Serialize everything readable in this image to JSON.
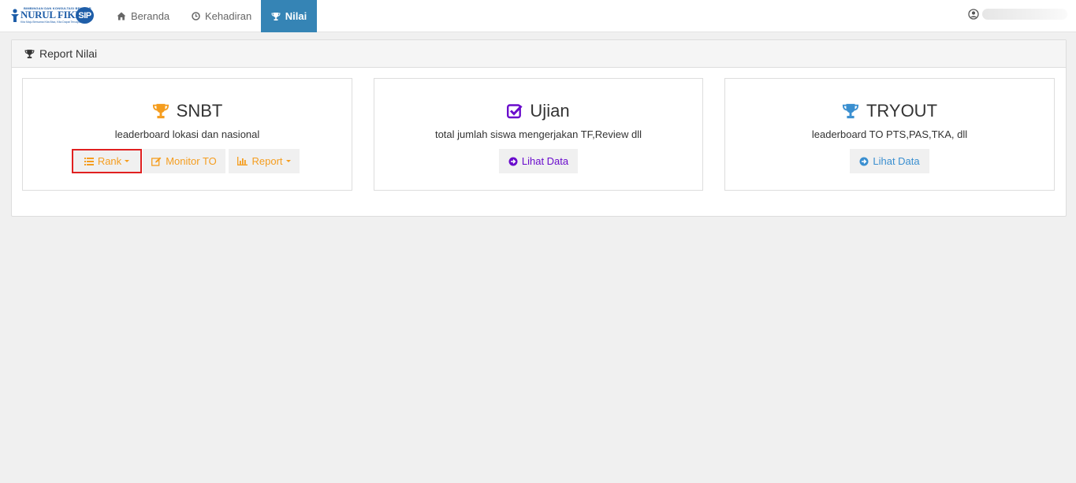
{
  "navbar": {
    "logo": {
      "tagline_top": "BIMBINGAN DAN KONSULTASI BELAJAR",
      "brand": "NURUL FIKRI",
      "badge": "SIP",
      "tagline_bottom": "Kita Maju Bersama Kita Bisa, Kita Dapat Tercapai"
    },
    "items": [
      {
        "label": "Beranda",
        "icon": "home-icon"
      },
      {
        "label": "Kehadiran",
        "icon": "clock-icon"
      },
      {
        "label": "Nilai",
        "icon": "trophy-icon",
        "active": true
      }
    ],
    "user_icon": "user-circle-icon"
  },
  "panel": {
    "title": "Report Nilai",
    "icon": "trophy-icon"
  },
  "cards": [
    {
      "title": "SNBT",
      "subtitle": "leaderboard lokasi dan nasional",
      "icon": "trophy-icon",
      "icon_color": "#f59d1e",
      "buttons": [
        {
          "label": "Rank",
          "icon": "list-icon",
          "dropdown": true
        },
        {
          "label": "Monitor TO",
          "icon": "edit-icon",
          "dropdown": false
        },
        {
          "label": "Report",
          "icon": "bar-chart-icon",
          "dropdown": true
        }
      ]
    },
    {
      "title": "Ujian",
      "subtitle": "total jumlah siswa mengerjakan TF,Review dll",
      "icon": "check-square-icon",
      "icon_color": "#6a0ccc",
      "buttons": [
        {
          "label": "Lihat Data",
          "icon": "arrow-circle-right-icon",
          "dropdown": false
        }
      ]
    },
    {
      "title": "TRYOUT",
      "subtitle": "leaderboard TO PTS,PAS,TKA, dll",
      "icon": "trophy-icon",
      "icon_color": "#3a8fd0",
      "buttons": [
        {
          "label": "Lihat Data",
          "icon": "arrow-circle-right-icon",
          "dropdown": false
        }
      ]
    }
  ],
  "colors": {
    "nav_active": "#3584b5",
    "orange": "#f59d1e",
    "purple": "#6a0ccc",
    "blue": "#3a8fd0",
    "highlight_border": "#e02020"
  }
}
